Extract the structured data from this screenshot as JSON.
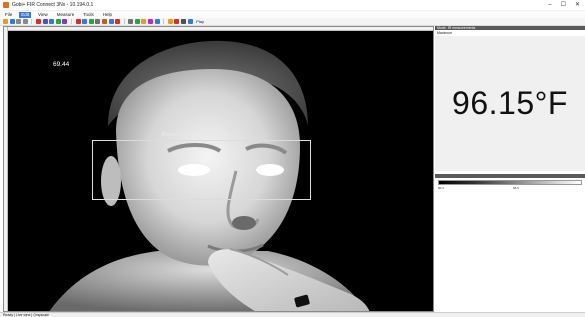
{
  "window": {
    "title": "Gobi+ FIR Connect 3Nx - 10.194.0.1",
    "minimize": "–",
    "maximize": "☐",
    "close": "✕"
  },
  "menu": {
    "items": [
      "File",
      "Edit",
      "View",
      "Measure",
      "Tools",
      "Help"
    ],
    "active_index": 1
  },
  "toolbar": {
    "icons": [
      {
        "name": "open-icon",
        "color": "#e0a020"
      },
      {
        "name": "save-icon",
        "color": "#3b78d8"
      },
      {
        "name": "arrow-left-icon",
        "color": "#888888"
      },
      {
        "name": "arrow-right-icon",
        "color": "#888888"
      },
      {
        "name": "record-icon",
        "color": "#d03030"
      },
      {
        "name": "snapshot-icon",
        "color": "#5050c0"
      },
      {
        "name": "grid-icon",
        "color": "#3b78d8"
      },
      {
        "name": "palette-icon",
        "color": "#30a040"
      },
      {
        "name": "image-icon",
        "color": "#8040b0"
      },
      {
        "name": "rect-roi-icon",
        "color": "#d03030"
      },
      {
        "name": "spot-icon",
        "color": "#3b78d8"
      },
      {
        "name": "line-roi-icon",
        "color": "#30a040"
      },
      {
        "name": "zoom-icon",
        "color": "#707070"
      },
      {
        "name": "chart-icon",
        "color": "#c06020"
      },
      {
        "name": "table-icon",
        "color": "#3b78d8"
      },
      {
        "name": "alarm-icon",
        "color": "#d03030"
      },
      {
        "name": "settings-icon",
        "color": "#707070"
      },
      {
        "name": "focus-icon",
        "color": "#30a040"
      },
      {
        "name": "nuc-icon",
        "color": "#e0a020"
      },
      {
        "name": "color-icon",
        "color": "#c030a0"
      },
      {
        "name": "emissivity-icon",
        "color": "#3b78d8"
      },
      {
        "name": "info-icon",
        "color": "#e0a020"
      },
      {
        "name": "stop-icon",
        "color": "#d03030"
      },
      {
        "name": "camera-icon",
        "color": "#505050"
      },
      {
        "name": "help-icon",
        "color": "#3b78d8"
      }
    ],
    "trailing_label": "Play"
  },
  "image": {
    "spot_temperature": "69.44",
    "roi_label": "Please Remove Eyewear"
  },
  "measurement_panel": {
    "header": "Mode: IR measurements",
    "subheader": "Maximum",
    "value": "96.15°F"
  },
  "palette": {
    "min_label": "80.4",
    "max_label": "98.3"
  },
  "status": {
    "text": "Ready | Live view | Grayscale"
  }
}
